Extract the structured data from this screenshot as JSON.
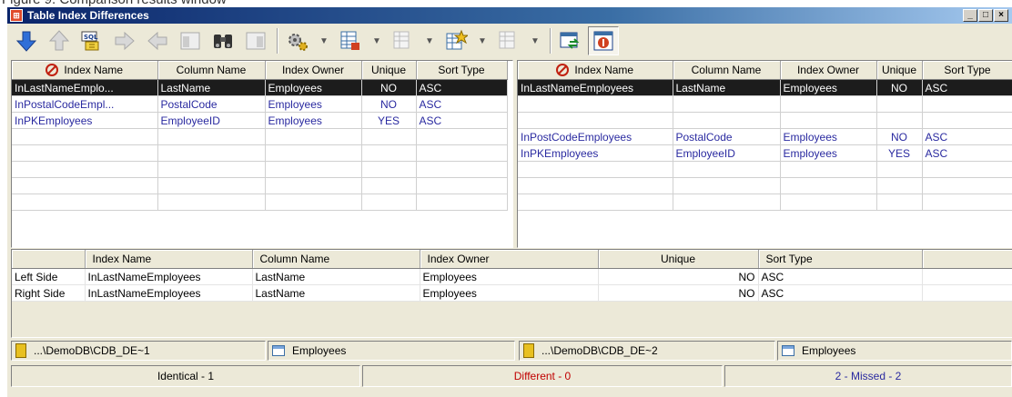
{
  "caption": "Figure 9. Comparison results window",
  "window": {
    "title": "Table Index Differences",
    "controls": [
      "_",
      "□",
      "×"
    ]
  },
  "toolbar": [
    {
      "name": "down-arrow-icon",
      "kind": "btn"
    },
    {
      "name": "up-arrow-icon",
      "kind": "btn"
    },
    {
      "name": "sql-icon",
      "kind": "btn"
    },
    {
      "name": "right-arrow-icon",
      "kind": "btn"
    },
    {
      "name": "left-arrow-icon",
      "kind": "btn"
    },
    {
      "name": "panel-icon",
      "kind": "btn"
    },
    {
      "name": "binoculars-icon",
      "kind": "btn"
    },
    {
      "name": "panel-alt-icon",
      "kind": "btn"
    }
  ],
  "columns": [
    "Index Name",
    "Column Name",
    "Index Owner",
    "Unique",
    "Sort Type"
  ],
  "left_rows": [
    {
      "name": "InLastNameEmplo...",
      "column": "LastName",
      "owner": "Employees",
      "unique": "NO",
      "sort": "ASC",
      "selected": true
    },
    {
      "name": "InPostalCodeEmpl...",
      "column": "PostalCode",
      "owner": "Employees",
      "unique": "NO",
      "sort": "ASC",
      "selected": false
    },
    {
      "name": "InPKEmployees",
      "column": "EmployeeID",
      "owner": "Employees",
      "unique": "YES",
      "sort": "ASC",
      "selected": false
    },
    {
      "name": "",
      "column": "",
      "owner": "",
      "unique": "",
      "sort": "",
      "selected": false
    },
    {
      "name": "",
      "column": "",
      "owner": "",
      "unique": "",
      "sort": "",
      "selected": false
    },
    {
      "name": "",
      "column": "",
      "owner": "",
      "unique": "",
      "sort": "",
      "selected": false
    },
    {
      "name": "",
      "column": "",
      "owner": "",
      "unique": "",
      "sort": "",
      "selected": false
    },
    {
      "name": "",
      "column": "",
      "owner": "",
      "unique": "",
      "sort": "",
      "selected": false
    }
  ],
  "right_rows": [
    {
      "name": "InLastNameEmployees",
      "column": "LastName",
      "owner": "Employees",
      "unique": "NO",
      "sort": "ASC",
      "selected": true
    },
    {
      "name": "",
      "column": "",
      "owner": "",
      "unique": "",
      "sort": "",
      "selected": false
    },
    {
      "name": "",
      "column": "",
      "owner": "",
      "unique": "",
      "sort": "",
      "selected": false
    },
    {
      "name": "InPostCodeEmployees",
      "column": "PostalCode",
      "owner": "Employees",
      "unique": "NO",
      "sort": "ASC",
      "selected": false
    },
    {
      "name": "InPKEmployees",
      "column": "EmployeeID",
      "owner": "Employees",
      "unique": "YES",
      "sort": "ASC",
      "selected": false
    },
    {
      "name": "",
      "column": "",
      "owner": "",
      "unique": "",
      "sort": "",
      "selected": false
    },
    {
      "name": "",
      "column": "",
      "owner": "",
      "unique": "",
      "sort": "",
      "selected": false
    },
    {
      "name": "",
      "column": "",
      "owner": "",
      "unique": "",
      "sort": "",
      "selected": false
    }
  ],
  "detail": {
    "rows": [
      {
        "side": "Left Side",
        "name": "InLastNameEmployees",
        "column": "LastName",
        "owner": "Employees",
        "unique": "NO",
        "sort": "ASC"
      },
      {
        "side": "Right Side",
        "name": "InLastNameEmployees",
        "column": "LastName",
        "owner": "Employees",
        "unique": "NO",
        "sort": "ASC"
      }
    ]
  },
  "sources": {
    "left_db": "...\\DemoDB\\CDB_DE~1",
    "left_table": "Employees",
    "right_db": "...\\DemoDB\\CDB_DE~2",
    "right_table": "Employees"
  },
  "status": {
    "identical": "Identical - 1",
    "different": "Different - 0",
    "missed": "2 - Missed - 2",
    "different_color": "#c00000",
    "missed_color": "#2a2aa0"
  }
}
